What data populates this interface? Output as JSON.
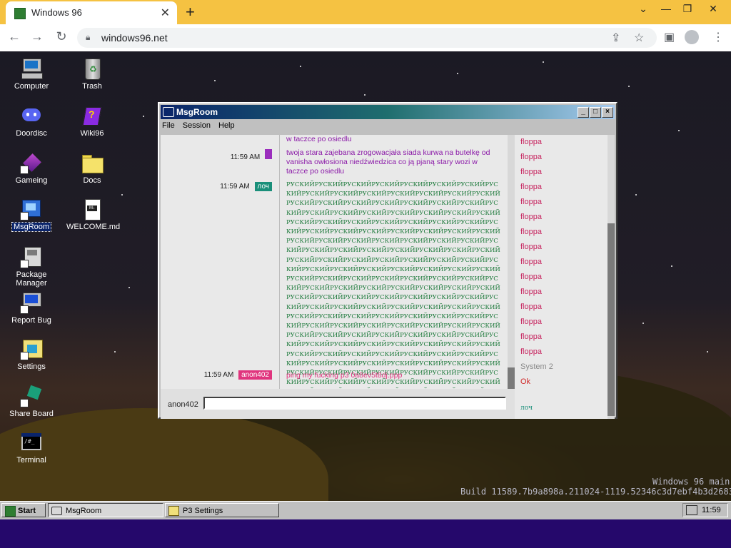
{
  "browser": {
    "tab_title": "Windows 96",
    "tab_close": "✕",
    "new_tab": "+",
    "url": "windows96.net",
    "controls": {
      "minimize": "⌄",
      "min": "—",
      "max": "❐",
      "close": "✕"
    }
  },
  "desktop_icons": [
    {
      "label": "Computer",
      "icon": "computer-icon"
    },
    {
      "label": "Trash",
      "icon": "trash-icon"
    },
    {
      "label": "Doordisc",
      "icon": "discord-icon"
    },
    {
      "label": "Wiki96",
      "icon": "wiki-icon"
    },
    {
      "label": "Gameing",
      "icon": "game-cube-icon"
    },
    {
      "label": "Docs",
      "icon": "folder-icon"
    },
    {
      "label": "MsgRoom",
      "icon": "msgroom-icon"
    },
    {
      "label": "WELCOME.md",
      "icon": "markdown-file-icon"
    },
    {
      "label": "Package Manager",
      "icon": "package-icon"
    },
    {
      "label": "Report Bug",
      "icon": "bug-report-icon"
    },
    {
      "label": "Settings",
      "icon": "settings-icon"
    },
    {
      "label": "Share Board",
      "icon": "share-board-icon"
    },
    {
      "label": "Terminal",
      "icon": "terminal-icon"
    }
  ],
  "window": {
    "title": "MsgRoom",
    "menu": [
      "File",
      "Session",
      "Help"
    ],
    "messages": [
      {
        "time": "",
        "user": "",
        "user_color": "",
        "text": "w taczce po osiedlu"
      },
      {
        "time": "11:59 AM",
        "user": "",
        "user_color": "#9b2ebd",
        "text": "twoja stara zajebana zrogowacjała siada kurwa na butelkę od vanisha owłosiona niedźwiedzica co ją pjaną stary wozi w taczce po osiedlu"
      },
      {
        "time": "11:59 AM",
        "user": "лоч",
        "user_color": "#1a8f7a",
        "text": "РУСКИЙРУСКИЙРУСКИЙРУСКИЙРУСКИЙРУСКИЙРУСКИЙРУСКИЙРУСКИЙРУСКИЙРУСКИЙРУСКИЙРУСКИЙРУСКИЙРУСКИЙРУСКИЙРУСКИЙРУСКИЙРУСКИЙРУСКИЙРУСКИЙРУСКИЙРУСКИЙРУСКИЙРУСКИЙРУСКИЙРУСКИЙРУСКИЙРУСКИЙРУСКИЙРУСКИЙРУСКИЙРУСКИЙРУСКИЙРУСКИЙРУСКИЙРУСКИЙРУСКИЙРУСКИЙРУСКИЙРУСКИЙРУСКИЙРУСКИЙРУСКИЙРУСКИЙРУСКИЙРУСКИЙРУСКИЙРУСКИЙРУСКИЙРУСКИЙРУСКИЙРУСКИЙРУСКИЙРУСКИЙРУСКИЙРУСКИЙРУСКИЙРУСКИЙРУСКИЙРУСКИЙРУСКИЙРУСКИЙРУСКИЙРУСКИЙРУСКИЙРУСКИЙРУСКИЙРУСКИЙРУСКИЙРУСКИЙРУСКИЙРУСКИЙРУСКИЙРУСКИЙРУСКИЙРУСКИЙРУСКИЙРУСКИЙРУСКИЙРУСКИЙРУСКИЙРУСКИЙРУСКИЙРУСКИЙРУСКИЙРУСКИЙРУСКИЙРУСКИЙРУСКИЙРУСКИЙРУСКИЙРУСКИЙРУСКИЙРУСКИЙРУСКИЙРУСКИЙРУСКИЙРУСКИЙРУСКИЙРУСКИЙРУСКИЙРУСКИЙРУСКИЙРУСКИЙРУСКИЙРУСКИЙРУСКИЙРУСКИЙРУСКИЙРУСКИЙРУСКИЙРУСКИЙРУСКИЙРУСКИЙРУСКИЙРУСКИЙРУСКИЙРУСКИЙРУСКИЙРУСКИЙРУСКИЙРУСКИЙРУСКИЙРУСКИЙРУСКИЙРУСКИЙРУСКИЙРУСКИЙРУСКИЙРУСКИЙРУСКИЙРУСКИЙРУСКИЙРУСКИЙРУСКИЙРУСКИЙРУСКИЙРУСКИЙРУСКИЙРУСКИЙРУСКИЙРУСКИЙРУСКИЙРУСКИЙРУСКИЙРУСКИЙРУСКИЙРУСКИЙРУСКИЙРУСКИЙРУСКИЙРУСКИЙРУСКИЙРУСКИЙРУСКИЙРУСКИЙРУСКИЙРУСКИЙРУСКИЙРУСКИЙРУСКИЙРУСКИЙРУСКИЙРУСКИЙРУСКИЙРУСКИЙРУСКИЙРУСКИЙРУСКИЙРУСКИЙРУСКИЙРУСКИЙ"
      },
      {
        "time": "11:59 AM",
        "user": "anon402",
        "user_color": "#e0357e",
        "text": "ping my fucking p3 0a8ev5t8dj.ppp"
      }
    ],
    "users": [
      {
        "name": "floppa",
        "color": "#c7245f"
      },
      {
        "name": "floppa",
        "color": "#c7245f"
      },
      {
        "name": "floppa",
        "color": "#c7245f"
      },
      {
        "name": "floppa",
        "color": "#c7245f"
      },
      {
        "name": "floppa",
        "color": "#c7245f"
      },
      {
        "name": "floppa",
        "color": "#c7245f"
      },
      {
        "name": "floppa",
        "color": "#c7245f"
      },
      {
        "name": "floppa",
        "color": "#c7245f"
      },
      {
        "name": "floppa",
        "color": "#c7245f"
      },
      {
        "name": "floppa",
        "color": "#c7245f"
      },
      {
        "name": "floppa",
        "color": "#c7245f"
      },
      {
        "name": "floppa",
        "color": "#c7245f"
      },
      {
        "name": "floppa",
        "color": "#c7245f"
      },
      {
        "name": "floppa",
        "color": "#c7245f"
      },
      {
        "name": "floppa",
        "color": "#c7245f"
      },
      {
        "name": "System 2",
        "color": "#8a8a8a"
      },
      {
        "name": "Ok",
        "color": "#d02a2a"
      },
      {
        "name": "лоч",
        "color": "#1a8f7a"
      }
    ],
    "nickname": "anon402",
    "input_value": ""
  },
  "watermark": {
    "line1": "Windows 96 main",
    "line2": "Build 11589.7b9a898a.211024-1119.52346c3d7ebf4b3d2683"
  },
  "taskbar": {
    "start": "Start",
    "tasks": [
      "MsgRoom",
      "P3 Settings"
    ],
    "clock": "11:59"
  }
}
